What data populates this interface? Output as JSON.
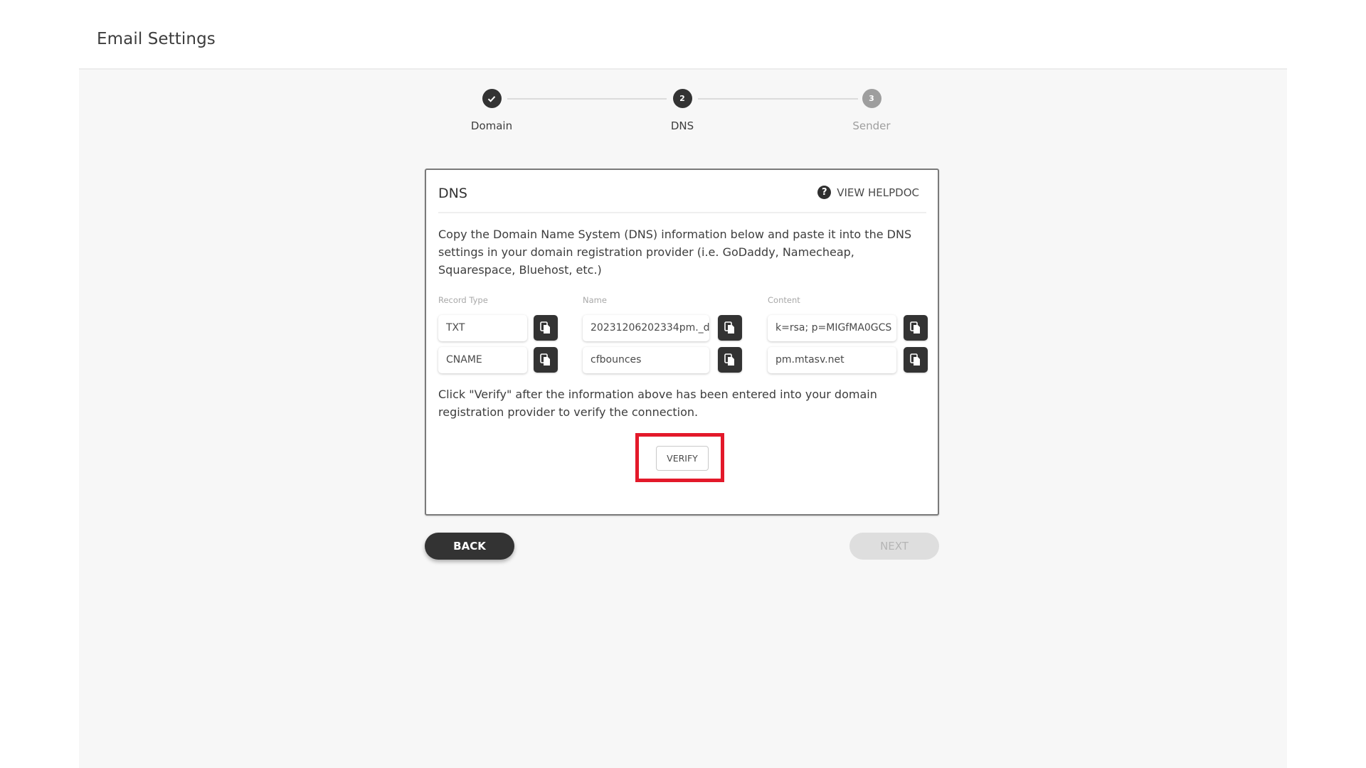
{
  "header": {
    "title": "Email Settings"
  },
  "stepper": {
    "steps": [
      {
        "label": "Domain",
        "number": "1",
        "status": "done",
        "icon": "check-icon"
      },
      {
        "label": "DNS",
        "number": "2",
        "status": "active"
      },
      {
        "label": "Sender",
        "number": "3",
        "status": "pending"
      }
    ]
  },
  "card": {
    "title": "DNS",
    "help_label": "VIEW HELPDOC",
    "help_icon": "question-circle-icon",
    "description": "Copy the Domain Name System (DNS) information below and paste it into the DNS settings in your domain registration provider (i.e. GoDaddy, Namecheap, Squarespace, Bluehost, etc.)",
    "columns": [
      "Record Type",
      "Name",
      "Content"
    ],
    "records": [
      {
        "type": "TXT",
        "name": "20231206202334pm._d",
        "content": "k=rsa; p=MIGfMA0GCS"
      },
      {
        "type": "CNAME",
        "name": "cfbounces",
        "content": "pm.mtasv.net"
      }
    ],
    "copy_icon": "copy-icon",
    "verify_text": "Click \"Verify\" after the information above has been entered into your domain registration provider to verify the connection.",
    "verify_label": "VERIFY",
    "highlight_color": "#e3192a"
  },
  "footer": {
    "back_label": "BACK",
    "next_label": "NEXT",
    "next_enabled": false
  }
}
